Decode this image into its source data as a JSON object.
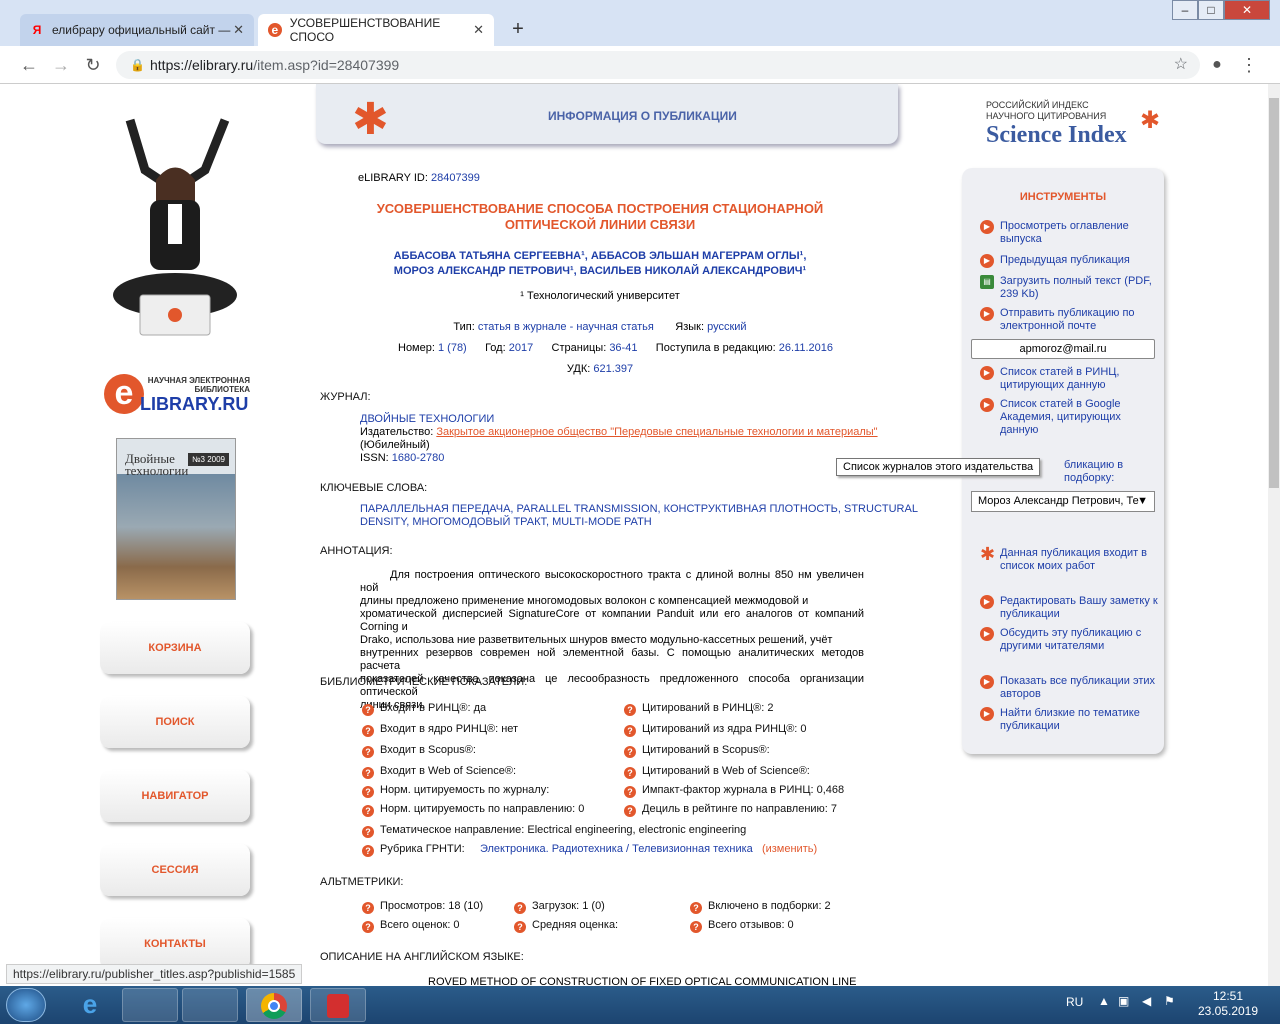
{
  "browser": {
    "tabs": [
      {
        "title": "елибрару официальный сайт —",
        "icon": "yandex-icon"
      },
      {
        "title": "УСОВЕРШЕНСТВОВАНИЕ СПОСО",
        "icon": "elibrary-favicon"
      }
    ],
    "url_host": "https://elibrary.ru",
    "url_path": "/item.asp?id=28407399",
    "status_url": "https://elibrary.ru/publisher_titles.asp?publishid=1585"
  },
  "header": {
    "banner": "ИНФОРМАЦИЯ О ПУБЛИКАЦИИ",
    "si_line1": "РОССИЙСКИЙ ИНДЕКС",
    "si_line2": "НАУЧНОГО ЦИТИРОВАНИЯ",
    "si_brand": "Science Index"
  },
  "logo": {
    "line1": "НАУЧНАЯ ЭЛЕКТРОННАЯ",
    "line2": "БИБЛИОТЕКА",
    "brand": "LIBRARY.RU"
  },
  "cover": {
    "title": "Двойные технологии",
    "issue": "№3 2009"
  },
  "menu": [
    "КОРЗИНА",
    "ПОИСК",
    "НАВИГАТОР",
    "СЕССИЯ",
    "КОНТАКТЫ"
  ],
  "pub": {
    "id_label": "eLIBRARY ID:",
    "id": "28407399",
    "title_line1": "УСОВЕРШЕНСТВОВАНИЕ СПОСОБА ПОСТРОЕНИЯ СТАЦИОНАРНОЙ",
    "title_line2": "ОПТИЧЕСКОЙ ЛИНИИ СВЯЗИ",
    "authors_line1": "АББАСОВА ТАТЬЯНА СЕРГЕЕВНА¹, АББАСОВ ЭЛЬШАН МАГЕРРАМ ОГЛЫ¹,",
    "authors_line2": "МОРОЗ АЛЕКСАНДР ПЕТРОВИЧ¹, ВАСИЛЬЕВ НИКОЛАЙ АЛЕКСАНДРОВИЧ¹",
    "affil": "¹ Технологический университет",
    "type_label": "Тип:",
    "type": "статья в журнале - научная статья",
    "lang_label": "Язык:",
    "lang": "русский",
    "num_label": "Номер:",
    "num": "1 (78)",
    "year_label": "Год:",
    "year": "2017",
    "pages_label": "Страницы:",
    "pages": "36-41",
    "recv_label": "Поступила в редакцию:",
    "recv": "26.11.2016",
    "udk_label": "УДК:",
    "udk": "621.397"
  },
  "journal": {
    "heading": "ЖУРНАЛ:",
    "name": "ДВОЙНЫЕ ТЕХНОЛОГИИ",
    "pub_label": "Издательство:",
    "publisher": "Закрытое акционерное общество \"Передовые специальные технологии и материалы\"",
    "note": "(Юбилейный)",
    "issn_label": "ISSN:",
    "issn": "1680-2780"
  },
  "tooltip": "Список журналов этого издательства",
  "keywords": {
    "heading": "КЛЮЧЕВЫЕ СЛОВА:",
    "line1": "ПАРАЛЛЕЛЬНАЯ ПЕРЕДАЧА, PARALLEL TRANSMISSION, КОНСТРУКТИВНАЯ ПЛОТНОСТЬ, STRUCTURAL",
    "line2": "DENSITY, МНОГОМОДОВЫЙ ТРАКТ, MULTI-MODE PATH"
  },
  "abstract": {
    "heading": "АННОТАЦИЯ:",
    "lines": [
      "Для построения оптического высокоскоростного тракта с длиной волны 850 нм увеличен ной",
      "длины предложено применение многомодовых волокон с компенсацией межмодовой и",
      "хроматической дисперсией SignatureCore от компании Panduit или его аналогов от компаний Corning и",
      "Drako, использова ние разветвительных шнуров вместо модульно-кассетных решений, учёт",
      "внутренних резервов современ ной элементной базы. С помощью аналитических методов расчета",
      "показателей качества показана це лесообразность предложенного способа организации оптической",
      "линии связи."
    ]
  },
  "biblio": {
    "heading": "БИБЛИОМЕТРИЧЕСКИЕ ПОКАЗАТЕЛИ:",
    "left": [
      "Входит в РИНЦ®: да",
      "Входит в ядро РИНЦ®: нет",
      "Входит в Scopus®:",
      "Входит в Web of Science®:",
      "Норм. цитируемость по журналу:",
      "Норм. цитируемость по направлению: 0"
    ],
    "right": [
      "Цитирований в РИНЦ®: 2",
      "Цитирований из ядра РИНЦ®: 0",
      "Цитирований в Scopus®:",
      "Цитирований в Web of Science®:",
      "Импакт-фактор журнала в РИНЦ: 0,468",
      "Дециль в рейтинге по направлению: 7"
    ],
    "topic": "Тематическое направление: Electrical engineering, electronic engineering",
    "grnti_label": "Рубрика ГРНТИ:",
    "grnti": "Электроника. Радиотехника / Телевизионная техника",
    "grnti_change": "(изменить)"
  },
  "alt": {
    "heading": "АЛЬТМЕТРИКИ:",
    "items": [
      "Просмотров: 18 (10)",
      "Загрузок: 1 (0)",
      "Включено в подборки: 2",
      "Всего оценок: 0",
      "Средняя оценка:",
      "Всего отзывов: 0"
    ]
  },
  "eng": {
    "heading": "ОПИСАНИЕ НА АНГЛИЙСКОМ ЯЗЫКЕ:",
    "title_fragment": "ROVED METHOD OF CONSTRUCTION OF FIXED OPTICAL COMMUNICATION LINE"
  },
  "tools": {
    "heading": "ИНСТРУМЕНТЫ",
    "items": [
      "Просмотреть оглавление выпуска",
      "Предыдущая публикация",
      "Загрузить полный текст (PDF, 239 Kb)",
      "Отправить публикацию по электронной почте",
      "Список статей в РИНЦ, цитирующих данную",
      "Список статей в Google Академия, цитирующих данную",
      "бликацию в подборку:",
      "Данная публикация входит в список моих работ",
      "Редактировать Вашу заметку к публикации",
      "Обсудить эту публикацию с другими читателями",
      "Показать все публикации этих авторов",
      "Найти близкие по тематике публикации"
    ],
    "email": "apmoroz@mail.ru",
    "select": "Мороз Александр Петрович, Те"
  },
  "taskbar": {
    "lang": "RU",
    "time": "12:51",
    "date": "23.05.2019"
  }
}
